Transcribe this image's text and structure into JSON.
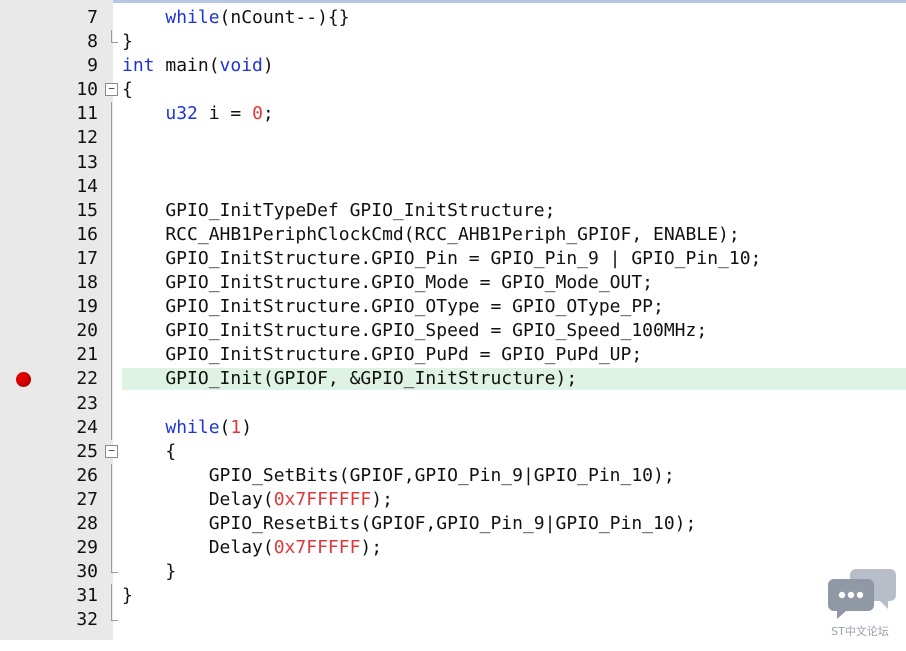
{
  "editor": {
    "breakpoint_line": 22,
    "lines": [
      {
        "n": "7",
        "segs": [
          {
            "t": "    "
          },
          {
            "t": "while",
            "c": "kw"
          },
          {
            "t": "(nCount--){}"
          }
        ],
        "fold": ""
      },
      {
        "n": "8",
        "segs": [
          {
            "t": "}"
          }
        ],
        "fold": "end"
      },
      {
        "n": "9",
        "segs": [
          {
            "t": "int",
            "c": "kw"
          },
          {
            "t": " main("
          },
          {
            "t": "void",
            "c": "kw"
          },
          {
            "t": ")"
          }
        ],
        "fold": ""
      },
      {
        "n": "10",
        "segs": [
          {
            "t": "{"
          }
        ],
        "fold": "box"
      },
      {
        "n": "11",
        "segs": [
          {
            "t": "    "
          },
          {
            "t": "u32",
            "c": "kw"
          },
          {
            "t": " i = "
          },
          {
            "t": "0",
            "c": "num"
          },
          {
            "t": ";"
          }
        ],
        "fold": "vline"
      },
      {
        "n": "12",
        "segs": [
          {
            "t": ""
          }
        ],
        "fold": "vline"
      },
      {
        "n": "13",
        "segs": [
          {
            "t": ""
          }
        ],
        "fold": "vline"
      },
      {
        "n": "14",
        "segs": [
          {
            "t": ""
          }
        ],
        "fold": "vline"
      },
      {
        "n": "15",
        "segs": [
          {
            "t": "    GPIO_InitTypeDef GPIO_InitStructure;"
          }
        ],
        "fold": "vline"
      },
      {
        "n": "16",
        "segs": [
          {
            "t": "    RCC_AHB1PeriphClockCmd(RCC_AHB1Periph_GPIOF, ENABLE);"
          }
        ],
        "fold": "vline"
      },
      {
        "n": "17",
        "segs": [
          {
            "t": "    GPIO_InitStructure.GPIO_Pin = GPIO_Pin_9 | GPIO_Pin_10;"
          }
        ],
        "fold": "vline"
      },
      {
        "n": "18",
        "segs": [
          {
            "t": "    GPIO_InitStructure.GPIO_Mode = GPIO_Mode_OUT;"
          }
        ],
        "fold": "vline"
      },
      {
        "n": "19",
        "segs": [
          {
            "t": "    GPIO_InitStructure.GPIO_OType = GPIO_OType_PP;"
          }
        ],
        "fold": "vline"
      },
      {
        "n": "20",
        "segs": [
          {
            "t": "    GPIO_InitStructure.GPIO_Speed = GPIO_Speed_100MHz;"
          }
        ],
        "fold": "vline"
      },
      {
        "n": "21",
        "segs": [
          {
            "t": "    GPIO_InitStructure.GPIO_PuPd = GPIO_PuPd_UP;"
          }
        ],
        "fold": "vline"
      },
      {
        "n": "22",
        "segs": [
          {
            "t": "    GPIO_Init(GPIOF, &GPIO_InitStructure);"
          }
        ],
        "fold": "vline",
        "highlight": true
      },
      {
        "n": "23",
        "segs": [
          {
            "t": ""
          }
        ],
        "fold": "vline"
      },
      {
        "n": "24",
        "segs": [
          {
            "t": "    "
          },
          {
            "t": "while",
            "c": "kw"
          },
          {
            "t": "("
          },
          {
            "t": "1",
            "c": "num"
          },
          {
            "t": ")"
          }
        ],
        "fold": "vline"
      },
      {
        "n": "25",
        "segs": [
          {
            "t": "    {"
          }
        ],
        "fold": "box"
      },
      {
        "n": "26",
        "segs": [
          {
            "t": "        GPIO_SetBits(GPIOF,GPIO_Pin_9|GPIO_Pin_10);"
          }
        ],
        "fold": "vline"
      },
      {
        "n": "27",
        "segs": [
          {
            "t": "        Delay("
          },
          {
            "t": "0x7FFFFFF",
            "c": "num"
          },
          {
            "t": ");"
          }
        ],
        "fold": "vline"
      },
      {
        "n": "28",
        "segs": [
          {
            "t": "        GPIO_ResetBits(GPIOF,GPIO_Pin_9|GPIO_Pin_10);"
          }
        ],
        "fold": "vline"
      },
      {
        "n": "29",
        "segs": [
          {
            "t": "        Delay("
          },
          {
            "t": "0x7FFFFF",
            "c": "num"
          },
          {
            "t": ");"
          }
        ],
        "fold": "vline"
      },
      {
        "n": "30",
        "segs": [
          {
            "t": "    }"
          }
        ],
        "fold": "end"
      },
      {
        "n": "31",
        "segs": [
          {
            "t": "}"
          }
        ],
        "fold": "vline"
      },
      {
        "n": "32",
        "segs": [
          {
            "t": ""
          }
        ],
        "fold": "end"
      }
    ]
  },
  "watermark": {
    "text": "ST中文论坛",
    "icon": "chat-bubbles-icon",
    "color": "#9aa1ab"
  },
  "colors": {
    "keyword": "#1d35d6",
    "number": "#e03838",
    "highlight": "#dff3e4",
    "gutter": "#e9e9e9",
    "breakpoint": "#e00000"
  }
}
